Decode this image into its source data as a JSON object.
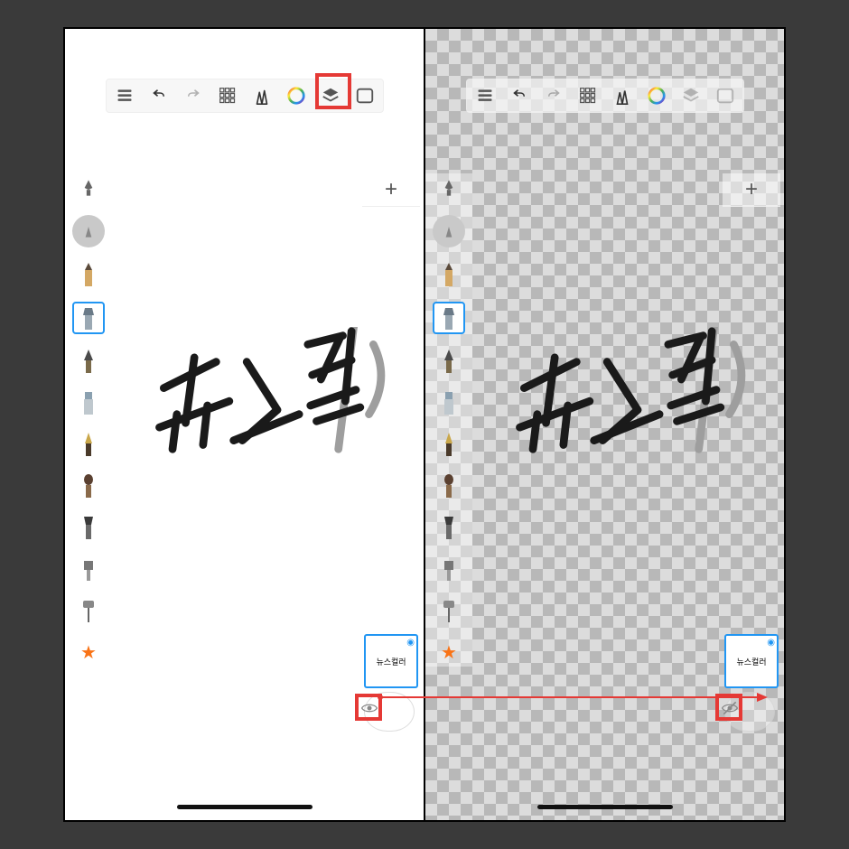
{
  "toolbar": {
    "items": [
      "menu",
      "undo",
      "redo",
      "shapes-grid",
      "tools",
      "color",
      "layers",
      "fullscreen"
    ],
    "left_disabled": [
      "redo"
    ],
    "right_disabled": [
      "redo",
      "layers",
      "fullscreen"
    ],
    "highlighted_left": "layers"
  },
  "brushes": {
    "top_icon": "brush-size",
    "items": [
      "pencil",
      "square-brush",
      "ink-brush",
      "flat-marker",
      "fountain-pen",
      "round-brush",
      "chisel",
      "airbrush",
      "roller",
      "smudge"
    ],
    "selected_index": 1,
    "star_label": "★"
  },
  "layers_panel": {
    "add_label": "+",
    "thumb_text": "뉴스컬러",
    "thumb_eye": "◉",
    "bg_eye_left": "visible",
    "bg_eye_right": "hidden"
  },
  "canvas": {
    "handwriting": "뉴스컬리",
    "ghost_stroke": true
  },
  "annotations": {
    "highlight_layers_button": true,
    "highlight_eye_left": true,
    "highlight_eye_right": true,
    "arrow_from": "eye_left",
    "arrow_to": "eye_right"
  },
  "colors": {
    "highlight": "#e53935",
    "selection": "#2196f3",
    "star": "#f97316"
  }
}
